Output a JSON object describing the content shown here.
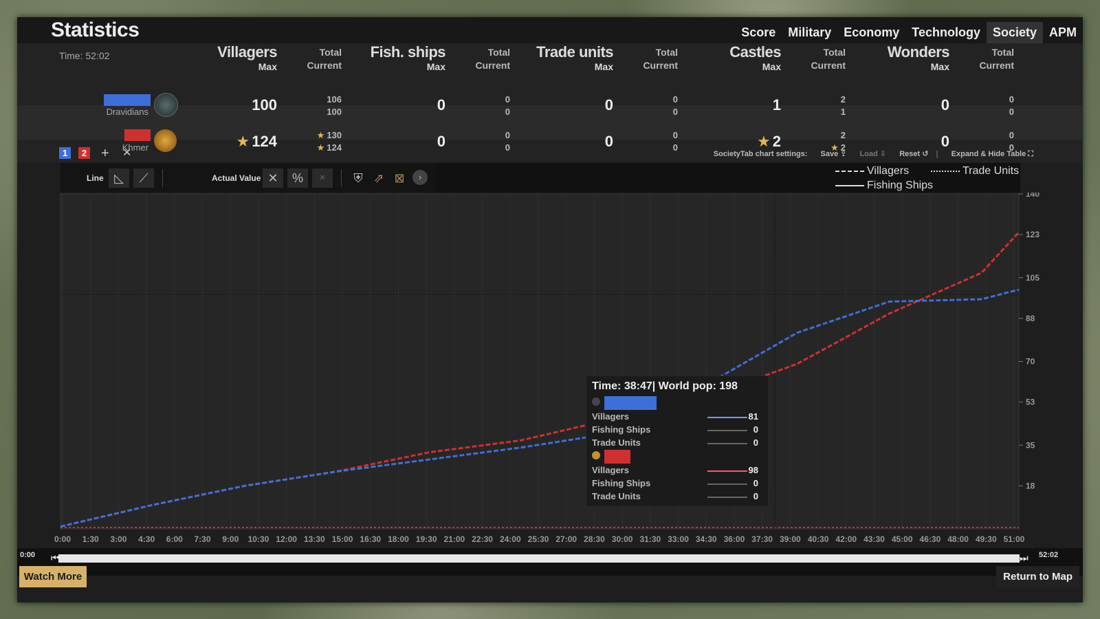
{
  "window": {
    "title": "Statistics"
  },
  "tabs": [
    {
      "label": "Score",
      "active": false
    },
    {
      "label": "Military",
      "active": false
    },
    {
      "label": "Economy",
      "active": false
    },
    {
      "label": "Technology",
      "active": false
    },
    {
      "label": "Society",
      "active": true
    },
    {
      "label": "APM",
      "active": false
    }
  ],
  "stats": {
    "time": "Time: 52:02",
    "columns": [
      {
        "title": "Villagers",
        "max_label": "Max",
        "total_label": "Total",
        "current_label": "Current"
      },
      {
        "title": "Fish. ships",
        "max_label": "Max",
        "total_label": "Total",
        "current_label": "Current"
      },
      {
        "title": "Trade units",
        "max_label": "Max",
        "total_label": "Total",
        "current_label": "Current"
      },
      {
        "title": "Castles",
        "max_label": "Max",
        "total_label": "Total",
        "current_label": "Current"
      },
      {
        "title": "Wonders",
        "max_label": "Max",
        "total_label": "Total",
        "current_label": "Current"
      }
    ],
    "players": [
      {
        "name": "Dravidians",
        "color": "#3e6fd8",
        "values": [
          {
            "max": "100",
            "total": "106",
            "current": "100",
            "max_star": false,
            "total_star": false,
            "current_star": false
          },
          {
            "max": "0",
            "total": "0",
            "current": "0"
          },
          {
            "max": "0",
            "total": "0",
            "current": "0"
          },
          {
            "max": "1",
            "total": "2",
            "current": "1"
          },
          {
            "max": "0",
            "total": "0",
            "current": "0"
          }
        ]
      },
      {
        "name": "Khmer",
        "color": "#d0302f",
        "values": [
          {
            "max": "124",
            "total": "130",
            "current": "124",
            "max_star": true,
            "total_star": true,
            "current_star": true
          },
          {
            "max": "0",
            "total": "0",
            "current": "0"
          },
          {
            "max": "0",
            "total": "0",
            "current": "0"
          },
          {
            "max": "2",
            "total": "2",
            "current": "2",
            "max_star": true,
            "current_star": true
          },
          {
            "max": "0",
            "total": "0",
            "current": "0"
          }
        ]
      }
    ]
  },
  "controls": {
    "player_buttons": [
      "1",
      "2"
    ],
    "add_icon": "+",
    "remove_icon": "✕",
    "settings_label": "SocietyTab chart settings:",
    "save": "Save",
    "load": "Load",
    "reset": "Reset",
    "expand": "Expand & Hide Table"
  },
  "toolbar": {
    "line_label": "Line",
    "actual_value_label": "Actual Value"
  },
  "legend": [
    {
      "label": "Villagers",
      "style": "dashed"
    },
    {
      "label": "Trade Units",
      "style": "dotted"
    },
    {
      "label": "Fishing Ships",
      "style": "solid"
    }
  ],
  "chart_data": {
    "type": "line",
    "x_unit": "seconds",
    "x": [
      0,
      300,
      600,
      900,
      1200,
      1500,
      1800,
      2100,
      2400,
      2700,
      3000,
      3122
    ],
    "x_tick_labels": [
      "0:00",
      "1:30",
      "3:00",
      "4:30",
      "6:00",
      "7:30",
      "9:00",
      "10:30",
      "12:00",
      "13:30",
      "15:00",
      "16:30",
      "18:00",
      "19:30",
      "21:00",
      "22:30",
      "24:00",
      "25:30",
      "27:00",
      "28:30",
      "30:00",
      "31:30",
      "33:00",
      "34:30",
      "36:00",
      "37:30",
      "39:00",
      "40:30",
      "42:00",
      "43:30",
      "45:00",
      "46:30",
      "48:00",
      "49:30",
      "51:00"
    ],
    "y_ticks": [
      18,
      35,
      53,
      70,
      88,
      105,
      123,
      140
    ],
    "ylim": [
      0,
      140
    ],
    "xlim": [
      0,
      3122
    ],
    "crosshair": {
      "x": 2327,
      "y": 98
    },
    "series": [
      {
        "name": "Villagers",
        "player": "Khmer",
        "color": "#d0302f",
        "values": [
          1,
          10,
          18,
          24,
          32,
          37,
          46,
          55,
          69,
          90,
          107,
          124
        ]
      },
      {
        "name": "Villagers",
        "player": "Dravidians",
        "color": "#3e6fd8",
        "values": [
          1,
          10,
          18,
          24,
          29,
          34,
          40,
          60,
          82,
          95,
          96,
          100
        ]
      }
    ]
  },
  "tooltip": {
    "title": "Time: 38:47| World pop: 198",
    "player1": {
      "color": "#3e6fd8",
      "rows": [
        {
          "label": "Villagers",
          "value": "81",
          "color": "#6aa0ff"
        },
        {
          "label": "Fishing Ships",
          "value": "0",
          "color": "#666"
        },
        {
          "label": "Trade Units",
          "value": "0",
          "color": "#666"
        }
      ]
    },
    "player2": {
      "color": "#d0302f",
      "rows": [
        {
          "label": "Villagers",
          "value": "98",
          "color": "#ff5b5b"
        },
        {
          "label": "Fishing Ships",
          "value": "0",
          "color": "#666"
        },
        {
          "label": "Trade Units",
          "value": "0",
          "color": "#666"
        }
      ]
    }
  },
  "timeline": {
    "start": "0:00",
    "end": "52:02"
  },
  "buttons": {
    "watch_more": "Watch More",
    "return_to_map": "Return to Map"
  }
}
